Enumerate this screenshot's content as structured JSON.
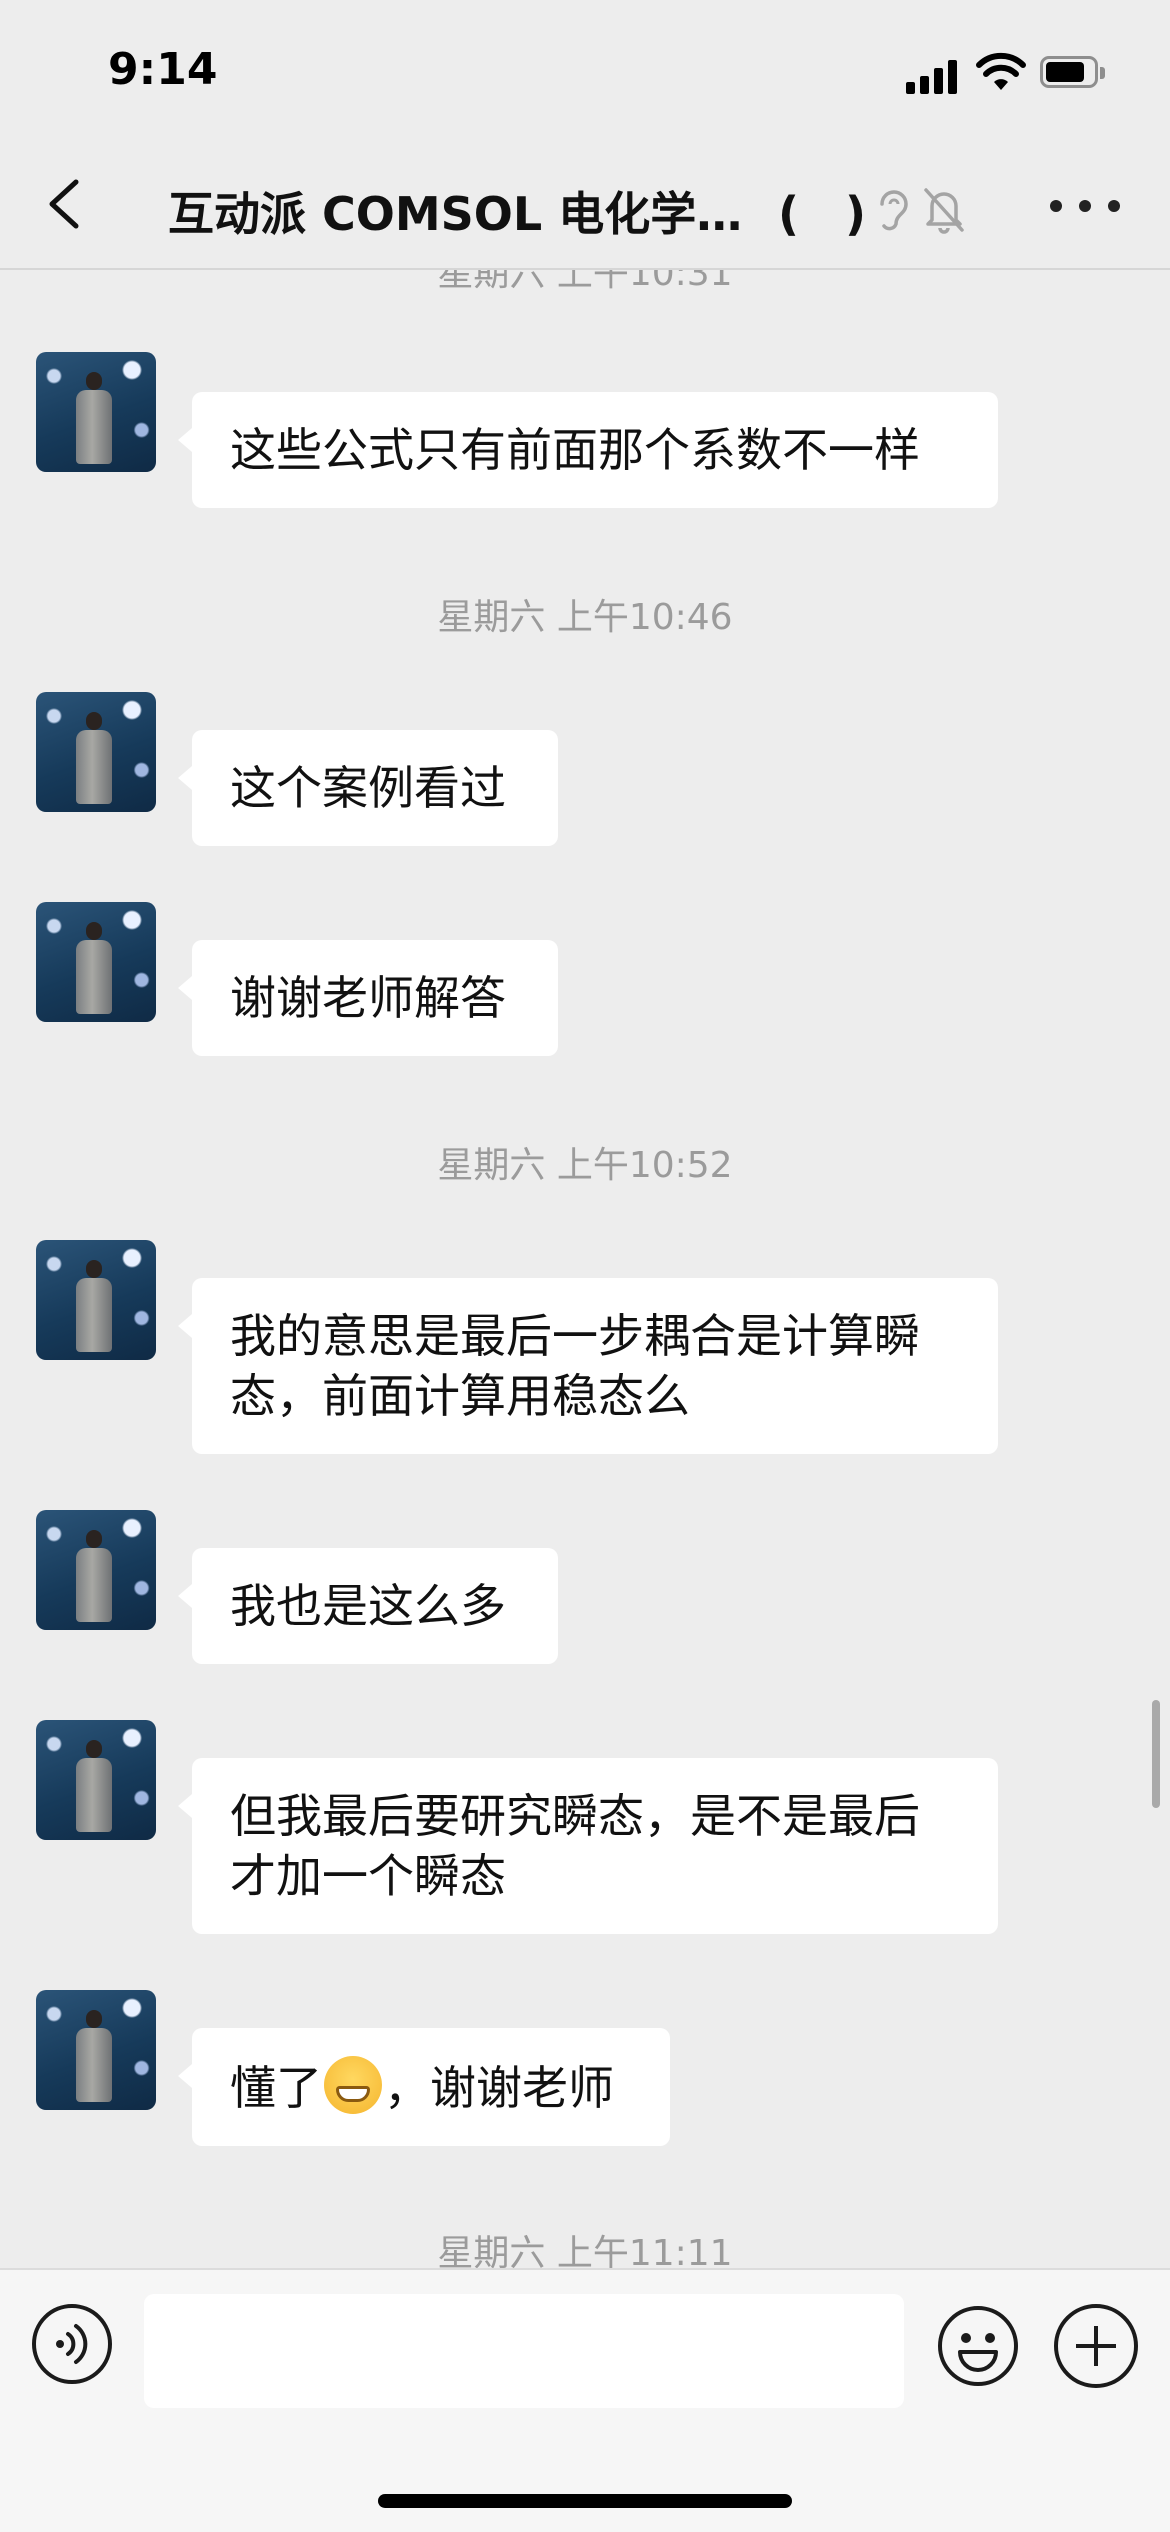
{
  "status_bar": {
    "time": "9:14"
  },
  "nav": {
    "title": "互动派 COMSOL 电化学…",
    "member_count": "(　)",
    "back_icon": "chevron-left-icon",
    "more_icon": "more-dots-icon"
  },
  "chat": {
    "top_timestamp_partial": "星期六 上午10:31",
    "messages": [
      {
        "text": "这些公式只有前面那个系数不一样"
      },
      {
        "timestamp": "星期六 上午10:46"
      },
      {
        "text": "这个案例看过"
      },
      {
        "text": "谢谢老师解答"
      },
      {
        "timestamp": "星期六 上午10:52"
      },
      {
        "text": "我的意思是最后一步耦合是计算瞬态，前面计算用稳态么"
      },
      {
        "text": "我也是这么多"
      },
      {
        "text": "但我最后要研究瞬态，是不是最后才加一个瞬态"
      },
      {
        "text_before": "懂了",
        "text_after": "，谢谢老师",
        "emoji": "grinning-face-emoji"
      },
      {
        "timestamp": "星期六 上午11:11"
      }
    ]
  },
  "input_bar": {
    "voice_icon": "voice-icon",
    "emoji_icon": "emoji-icon",
    "plus_icon": "plus-icon",
    "input_value": ""
  }
}
